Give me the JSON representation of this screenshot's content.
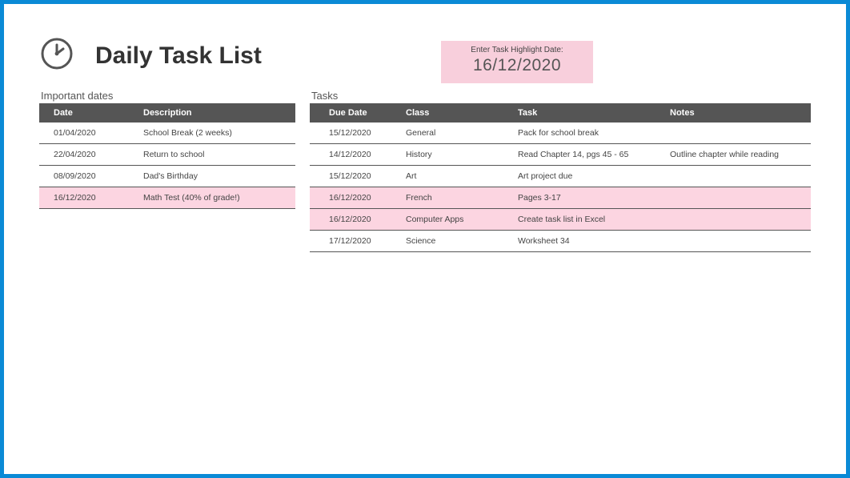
{
  "title": "Daily Task List",
  "highlight": {
    "label": "Enter Task Highlight Date:",
    "date": "16/12/2020"
  },
  "important_dates": {
    "section_title": "Important dates",
    "columns": [
      "Date",
      "Description"
    ],
    "rows": [
      {
        "date": "01/04/2020",
        "desc": "School Break (2 weeks)",
        "hl": false
      },
      {
        "date": "22/04/2020",
        "desc": "Return to school",
        "hl": false
      },
      {
        "date": "08/09/2020",
        "desc": "Dad's Birthday",
        "hl": false
      },
      {
        "date": "16/12/2020",
        "desc": "Math Test (40% of grade!)",
        "hl": true
      }
    ]
  },
  "tasks": {
    "section_title": "Tasks",
    "columns": [
      "Due Date",
      "Class",
      "Task",
      "Notes"
    ],
    "rows": [
      {
        "due": "15/12/2020",
        "class": "General",
        "task": "Pack for school break",
        "notes": "",
        "hl": false
      },
      {
        "due": "14/12/2020",
        "class": "History",
        "task": "Read Chapter 14, pgs 45 - 65",
        "notes": "Outline chapter while reading",
        "hl": false
      },
      {
        "due": "15/12/2020",
        "class": "Art",
        "task": "Art project due",
        "notes": "",
        "hl": false
      },
      {
        "due": "16/12/2020",
        "class": "French",
        "task": "Pages 3-17",
        "notes": "",
        "hl": true
      },
      {
        "due": "16/12/2020",
        "class": "Computer Apps",
        "task": "Create task list in Excel",
        "notes": "",
        "hl": true
      },
      {
        "due": "17/12/2020",
        "class": "Science",
        "task": "Worksheet 34",
        "notes": "",
        "hl": false
      }
    ]
  }
}
